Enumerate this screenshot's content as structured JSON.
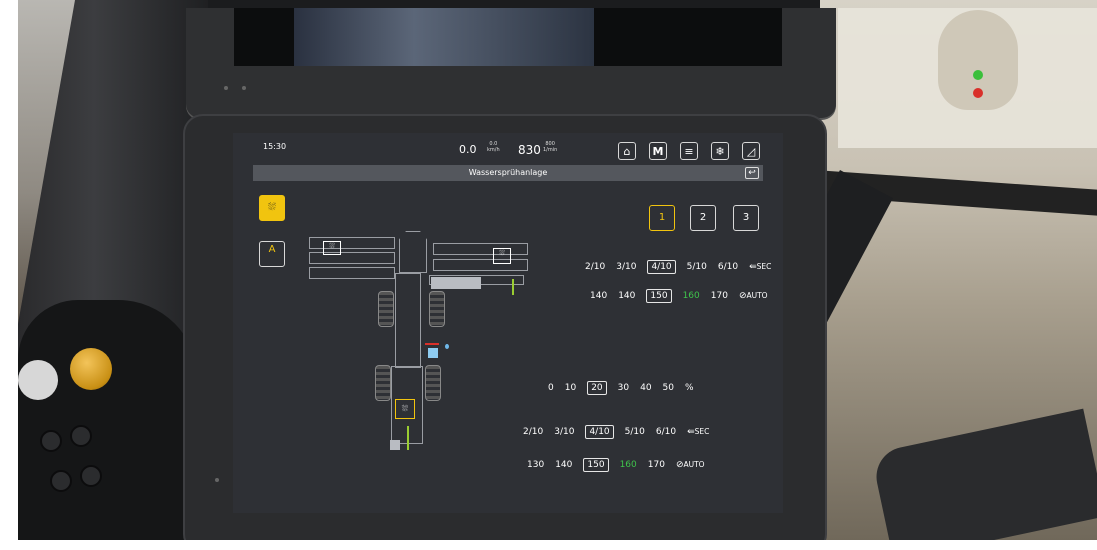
{
  "header": {
    "time": "15:30",
    "speed": "0.0",
    "speed_unit_top": "0.0",
    "speed_unit_bottom": "km/h",
    "rpm": "830",
    "rpm_unit_top": "800",
    "rpm_unit_bottom": "1/min",
    "buttons": [
      "home",
      "M",
      "notes",
      "snowflake",
      "wipe"
    ],
    "m_label": "M"
  },
  "title_bar": {
    "title": "Wassersprühanlage",
    "back": "↩"
  },
  "left_buttons": {
    "top_label": "",
    "auto_label": "A"
  },
  "right_buttons": [
    "1",
    "2",
    "3"
  ],
  "upper_fraction_row": [
    "2/10",
    "3/10",
    "4/10",
    "5/10",
    "6/10"
  ],
  "upper_fraction_selected": "4/10",
  "upper_sec_label": "SEC",
  "upper_number_row": [
    "140",
    "140",
    "150",
    "160",
    "170"
  ],
  "upper_number_selected": "150",
  "upper_number_green": "160",
  "upper_auto_label": "AUTO",
  "percent_row": [
    "0",
    "10",
    "20",
    "30",
    "40",
    "50",
    "%"
  ],
  "percent_selected": "20",
  "lower_fraction_row": [
    "2/10",
    "3/10",
    "4/10",
    "5/10",
    "6/10"
  ],
  "lower_fraction_selected": "4/10",
  "lower_sec_label": "SEC",
  "lower_number_row": [
    "130",
    "140",
    "150",
    "160",
    "170"
  ],
  "lower_number_selected": "150",
  "lower_number_green": "160",
  "lower_auto_label": "AUTO",
  "colors": {
    "accent_yellow": "#f1c40f",
    "highlight_green": "#3fc34b",
    "screen_bg": "#2e3035",
    "title_bar": "#54575d"
  }
}
